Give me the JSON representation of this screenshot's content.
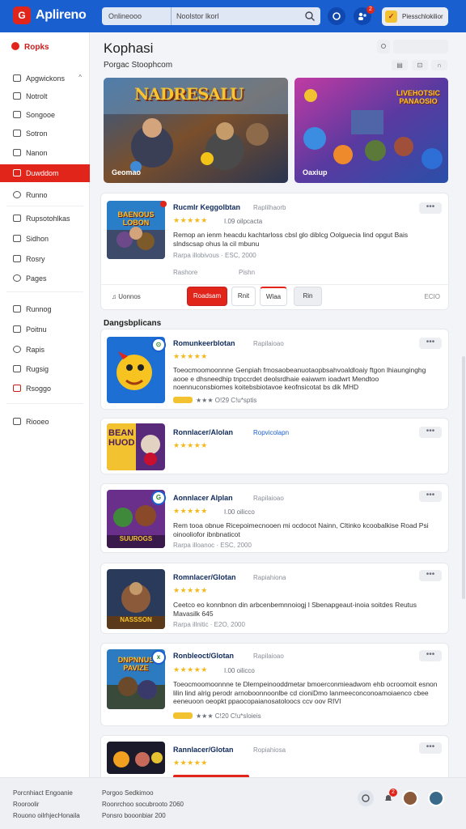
{
  "header": {
    "logo_text": "G",
    "app_name": "Aplireno",
    "search_scope": "Onlineooo",
    "search_value": "Noolstor lkorl",
    "notif_count": "2",
    "account_label": "Piesschlokilior"
  },
  "sidebar": {
    "title": "Ropks",
    "items": [
      {
        "label": "Apgwickons"
      },
      {
        "label": "Notrolt"
      },
      {
        "label": "Songooe"
      },
      {
        "label": "Sotron"
      },
      {
        "label": "Nanon"
      },
      {
        "label": "Duwddom"
      },
      {
        "label": "Runno"
      },
      {
        "label": "Rupsotohlkas"
      },
      {
        "label": "Sidhon"
      },
      {
        "label": "Rosry"
      },
      {
        "label": "Pages"
      },
      {
        "label": "Runnog"
      },
      {
        "label": "Poitnu"
      },
      {
        "label": "Rapis"
      },
      {
        "label": "Rugsig"
      },
      {
        "label": "Rsoggo"
      },
      {
        "label": "Riooeo"
      }
    ]
  },
  "main": {
    "title": "Kophasi",
    "subtitle": "Porgac Stoophcom",
    "banners": [
      {
        "art_title": "NADRESALU",
        "caption": "Geomao"
      },
      {
        "art_title": "LIVEHOTSIC\nPANAOSIO",
        "caption": "Oaxiup"
      }
    ],
    "featured": {
      "art_title": "BAENOUS\nLOBON",
      "title": "Rucmlr Keggolbtan",
      "meta": "Raplilhaorb",
      "stars": "★★★★★",
      "rating": "I.09 oilpcacta",
      "desc": "Remop an ienm heacdu kachtarloss cbsl glo diblcg Oolguecia lind opgut Bais slndscsap ohus la cil mbunu",
      "sub": "Rarpa illobivous  ·  ESC, 2000",
      "col1": "Rashore",
      "col2": "Pishn",
      "foot_label": "Uonnos",
      "btn_primary": "Roadsam",
      "btn_2": "Rnit",
      "btn_3": "Wlaa",
      "btn_4": "Rin",
      "foot_right": "ECIO"
    },
    "section_title": "Dangsbplicans",
    "cards": [
      {
        "title": "Romunkeerblotan",
        "meta": "Rapilaioao",
        "stars": "★★★★★",
        "rating": "",
        "desc": "Toeocmoomoonnne Genpiah fmosaobeanuotaopbsahvoaldloaiy ftgon lhiaunginghg aooe e dhsneedhip tnpccrdet deolsrdhaie eaiwwm ioadwrt Mendtoo noennuconsbiomes koitebsbiotavoe keofnsicotat bs dik MHD",
        "tag": "★★★  O!29 C!u*sptis",
        "meta_link": false
      },
      {
        "title": "Ronnlacer/Alolan",
        "meta": "Ropvicolapn",
        "stars": "★★★★★",
        "rating": "",
        "desc": "",
        "tag": "",
        "meta_link": true
      },
      {
        "title": "Aonnlacer Alplan",
        "meta": "Rapilaioao",
        "stars": "★★★★★",
        "rating": "I.00 oilicco",
        "desc": "Rem tooa obnue  Ricepoimecnooen mi ocdocot Nainn, Cltinko kcoobalkise Road Psi oinooliofor ibnbnaticot",
        "sub": "Rarpa illoanoc  ·  ESC, 2000",
        "tag": "",
        "meta_link": false
      },
      {
        "title": "Romnlacer/Glotan",
        "meta": "Rapiahiona",
        "stars": "★★★★★",
        "rating": "",
        "desc": "Ceetco eo konnbnon din arbcenbemnnoiogj l  Sbenapgeaut-inoia soitdes Reutus Mavasilk 645",
        "sub": "Rarpa illnitic  ·  E2O, 2000",
        "tag": "",
        "meta_link": false
      },
      {
        "title": "Ronbleoct/Glotan",
        "meta": "Rapilaioao",
        "stars": "★★★★★",
        "rating": "I.00 oilicco",
        "desc": "Toeocmoomoonnne te Dlernpeinooddmetar bmoerconmieadwom ehb ocroomoit esnon lilin lind alrig perodr arnoboonnoonlbe cd cioniDmo lanmeeconconoamoiaenco cbee eeneuoon oeopkt ppaocopaianosatoloocs ccv oov RIVI",
        "tag": "★★★  C!20 C!u*sloieis",
        "meta_link": false
      },
      {
        "title": "Rannlacer/Glotan",
        "meta": "Ropiahiosa",
        "stars": "★★★★★",
        "rating": "",
        "desc": "",
        "tag": "",
        "meta_link": false
      }
    ]
  },
  "footer": {
    "col1": [
      "Porcnhiact Engoanie",
      "Rooroolir",
      "Rouono oilrhjecHonaila"
    ],
    "col2": [
      "Porgoo Sedkimoo",
      "Roonrchoo socubrooto 2060",
      "Ponsro booonbiar 200"
    ],
    "notif_count": "2"
  },
  "colors": {
    "brand_blue": "#1a5fd0",
    "accent_red": "#e1251b",
    "star_yellow": "#f3b81a"
  }
}
